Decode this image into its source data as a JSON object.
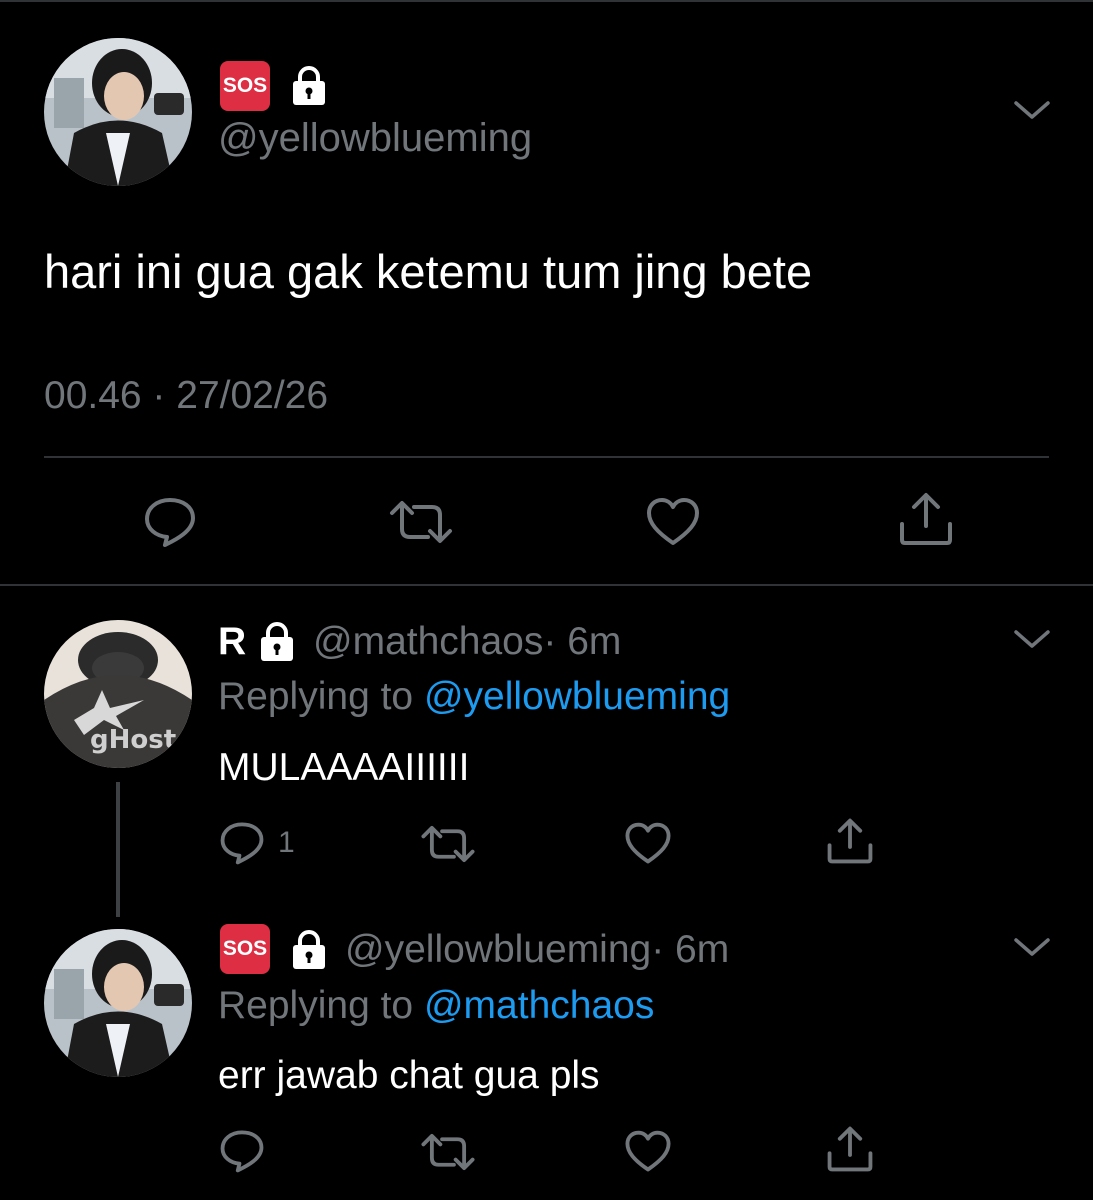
{
  "main_tweet": {
    "badge": "SOS",
    "handle": "@yellowblueming",
    "text": "hari ini gua gak ketemu tum jing bete",
    "timestamp": "00.46 · 27/02/26",
    "avatar_icon": "user-avatar-photo",
    "lock_icon": "lock-icon"
  },
  "replies": [
    {
      "name": "R",
      "handle": "@mathchaos",
      "time": "· 6m",
      "replying_label": "Replying to",
      "replying_to": "@yellowblueming",
      "text": "MULAAAAIIIIII",
      "reply_count": "1"
    },
    {
      "badge": "SOS",
      "handle": "@yellowblueming",
      "time": "· 6m",
      "replying_label": "Replying to",
      "replying_to": "@mathchaos",
      "text": "err jawab chat gua pls",
      "reply_count": ""
    }
  ],
  "colors": {
    "background": "#000000",
    "text": "#ffffff",
    "secondary": "#71767b",
    "link": "#1d9bf0",
    "divider": "#2f3336",
    "sos_badge": "#dd2e44"
  }
}
